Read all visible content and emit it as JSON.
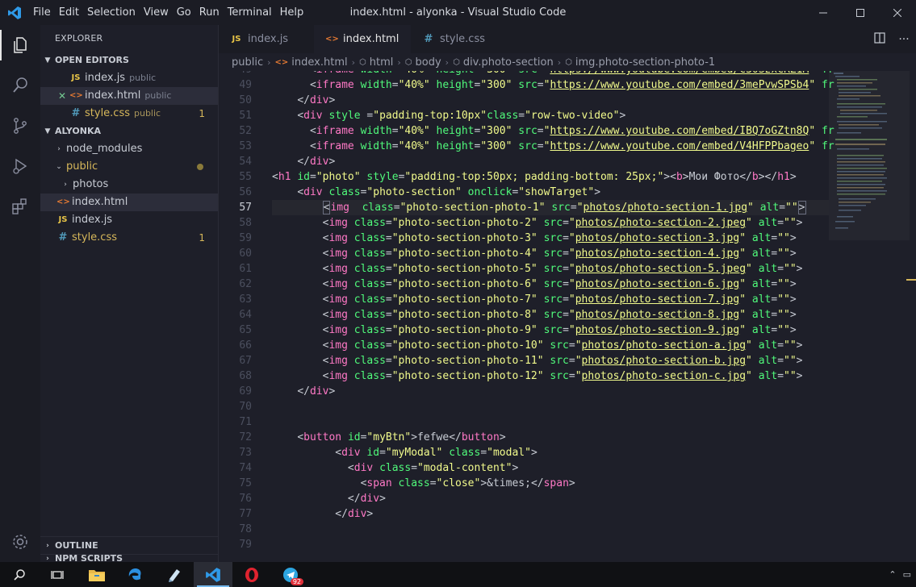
{
  "window": {
    "title": "index.html - alyonka - Visual Studio Code",
    "menu": [
      "File",
      "Edit",
      "Selection",
      "View",
      "Go",
      "Run",
      "Terminal",
      "Help"
    ]
  },
  "sidebar": {
    "title": "EXPLORER",
    "open_editors": {
      "label": "OPEN EDITORS",
      "items": [
        {
          "icon": "JS",
          "name": "index.js",
          "desc": "public"
        },
        {
          "icon": "<>",
          "name": "index.html",
          "desc": "public"
        },
        {
          "icon": "#",
          "name": "style.css",
          "desc": "public",
          "count": "1"
        }
      ]
    },
    "workspace": {
      "label": "ALYONKA",
      "items": [
        {
          "name": "node_modules"
        },
        {
          "name": "public"
        },
        {
          "name": "photos"
        },
        {
          "icon": "<>",
          "name": "index.html"
        },
        {
          "icon": "JS",
          "name": "index.js"
        },
        {
          "icon": "#",
          "name": "style.css",
          "count": "1"
        }
      ]
    },
    "outline_label": "OUTLINE",
    "npm_label": "NPM SCRIPTS"
  },
  "tabs": [
    {
      "icon": "JS",
      "label": "index.js"
    },
    {
      "icon": "<>",
      "label": "index.html"
    },
    {
      "icon": "#",
      "label": "style.css"
    }
  ],
  "breadcrumb": [
    "public",
    "index.html",
    "html",
    "body",
    "div.photo-section",
    "img.photo-section-photo-1"
  ],
  "editor": {
    "line_numbers": [
      "49",
      "49",
      "50",
      "51",
      "52",
      "53",
      "54",
      "55",
      "56",
      "57",
      "58",
      "59",
      "60",
      "61",
      "62",
      "63",
      "64",
      "65",
      "66",
      "67",
      "68",
      "69",
      "70",
      "71",
      "72",
      "73",
      "74",
      "75",
      "76",
      "77",
      "78",
      "79"
    ]
  },
  "taskbar": {
    "telegram_badge": "92"
  },
  "colors": {
    "background": "#1e1f29",
    "tag": "#ff79c6",
    "attribute": "#50fa7b",
    "string": "#f1fa8c",
    "accent": "#007acc"
  }
}
